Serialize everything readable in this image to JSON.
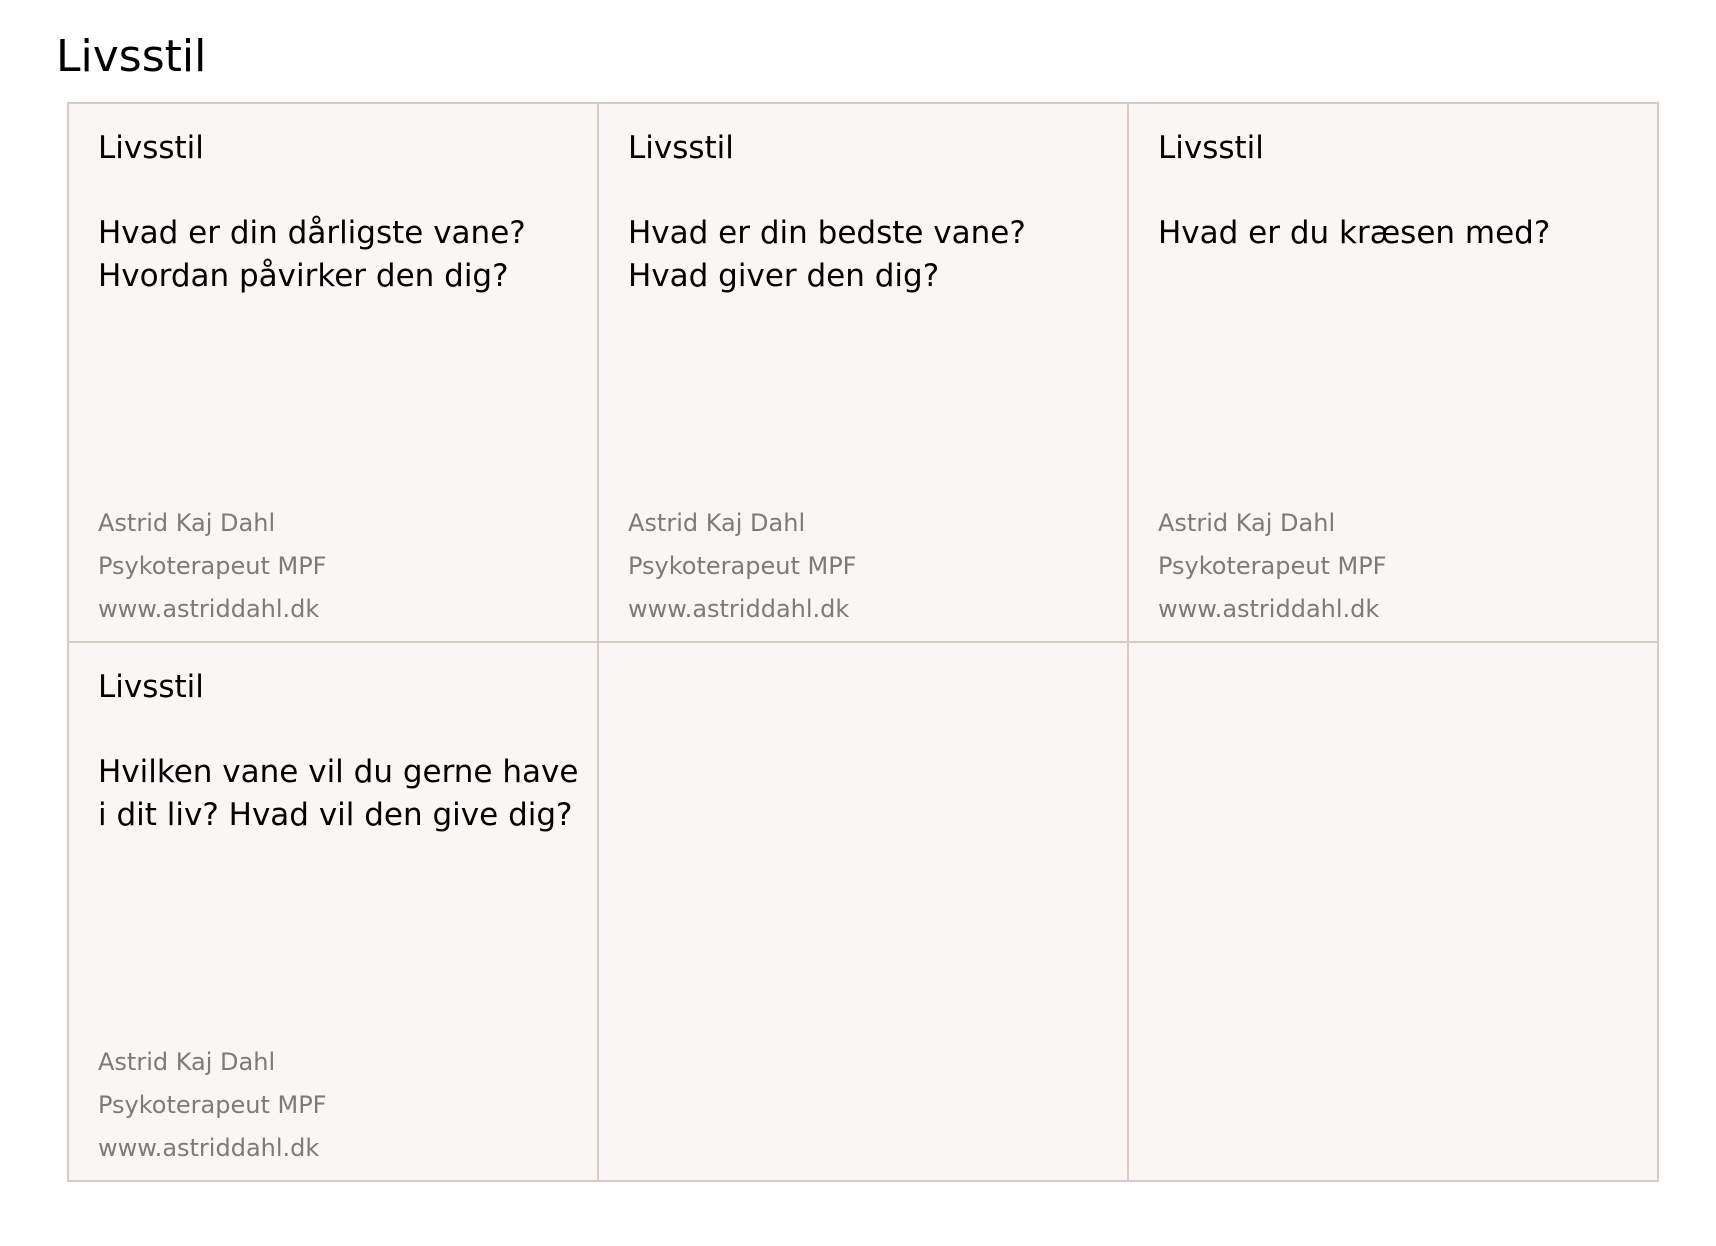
{
  "page": {
    "title": "Livsstil"
  },
  "cards": [
    {
      "category": "Livsstil",
      "question": "Hvad er din dårligste vane? Hvordan påvirker den dig?",
      "footer": {
        "name": "Astrid Kaj Dahl",
        "profession": "Psykoterapeut MPF",
        "website": "www.astriddahl.dk"
      }
    },
    {
      "category": "Livsstil",
      "question": "Hvad er din bedste vane? Hvad giver den dig?",
      "footer": {
        "name": "Astrid Kaj Dahl",
        "profession": "Psykoterapeut MPF",
        "website": "www.astriddahl.dk"
      }
    },
    {
      "category": "Livsstil",
      "question": "Hvad er du kræsen med?",
      "footer": {
        "name": "Astrid Kaj Dahl",
        "profession": "Psykoterapeut MPF",
        "website": "www.astriddahl.dk"
      }
    },
    {
      "category": "Livsstil",
      "question": "Hvilken vane vil du gerne have i dit liv? Hvad vil den give dig?",
      "footer": {
        "name": "Astrid Kaj Dahl",
        "profession": "Psykoterapeut MPF",
        "website": "www.astriddahl.dk"
      }
    }
  ],
  "colors": {
    "card_background": "#faf6f3",
    "card_border": "#d7c9c6",
    "footer_text": "#7b7b7b"
  }
}
